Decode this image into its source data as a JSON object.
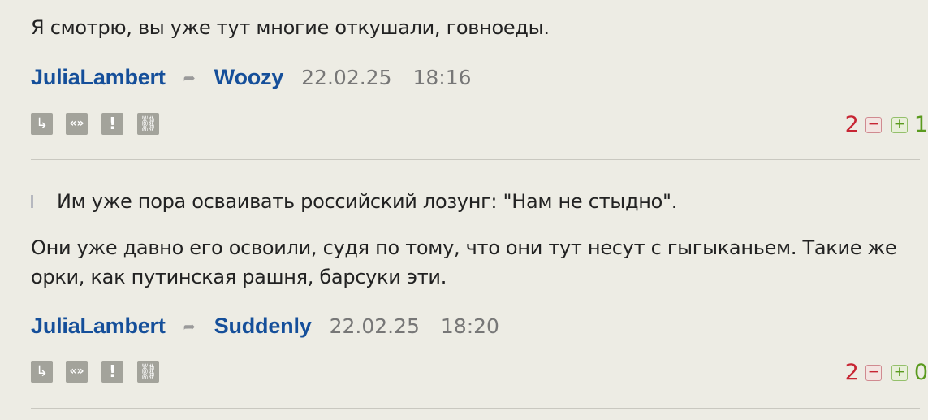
{
  "comments": [
    {
      "text": "Я смотрю, вы уже тут многие откушали, говноеды.",
      "author": "JuliaLambert",
      "reply_to": "Woozy",
      "date": "22.02.25",
      "time": "18:16",
      "votes_down": "2",
      "votes_up": "1"
    },
    {
      "quote": "Им уже пора осваивать российский лозунг: \"Нам не стыдно\".",
      "text": "Они уже давно его освоили, судя по тому, что они тут несут с гыгыканьем. Такие же орки, как путинская рашня, барсуки эти.",
      "author": "JuliaLambert",
      "reply_to": "Suddenly",
      "date": "22.02.25",
      "time": "18:20",
      "votes_down": "2",
      "votes_up": "0"
    }
  ],
  "icons": {
    "reply": "reply-icon",
    "quote": "quote-icon",
    "report": "report-icon",
    "link": "link-icon",
    "reply_arrow": "reply-arrow-icon",
    "vote_down": "minus-icon",
    "vote_up": "plus-icon"
  },
  "colors": {
    "background": "#edece4",
    "link": "#154f9a",
    "negative": "#c72533",
    "positive": "#5a9a1e",
    "button": "#a3a39b"
  }
}
